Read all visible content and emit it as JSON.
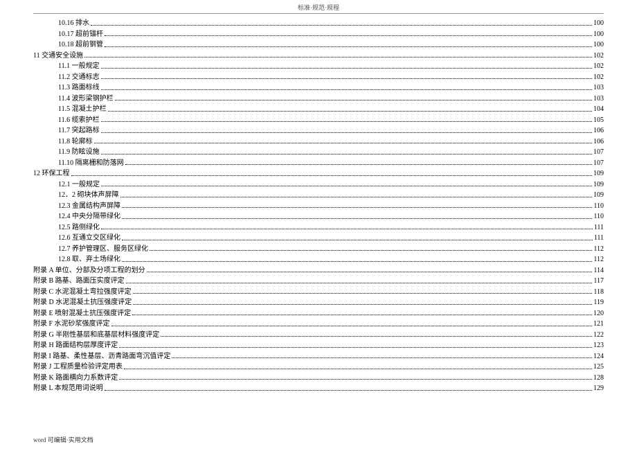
{
  "header": "标准·规范·规程",
  "footer": "word 可编辑·实用文档",
  "toc": [
    {
      "indent": 2,
      "num": "10.16",
      "title": "排水",
      "page": "100"
    },
    {
      "indent": 2,
      "num": "10.17",
      "title": "超前锚杆",
      "page": "100"
    },
    {
      "indent": 2,
      "num": "10.18",
      "title": "超前钢管",
      "page": "100"
    },
    {
      "indent": 0,
      "num": "11",
      "title": "交通安全设施",
      "page": "102"
    },
    {
      "indent": 2,
      "num": "11.1",
      "title": "一般规定",
      "page": "102"
    },
    {
      "indent": 2,
      "num": "11.2",
      "title": "交通标志",
      "page": "102"
    },
    {
      "indent": 2,
      "num": "11.3",
      "title": "路面标线",
      "page": "103"
    },
    {
      "indent": 2,
      "num": "11.4",
      "title": "波形梁钢护栏",
      "page": "103"
    },
    {
      "indent": 2,
      "num": "11.5",
      "title": "混凝土护栏",
      "page": "104"
    },
    {
      "indent": 2,
      "num": "11.6",
      "title": "缆索护栏",
      "page": "105"
    },
    {
      "indent": 2,
      "num": "11.7",
      "title": "突起路标",
      "page": "106"
    },
    {
      "indent": 2,
      "num": "11.8",
      "title": "轮廓标",
      "page": "106"
    },
    {
      "indent": 2,
      "num": "11.9",
      "title": "防眩设施",
      "page": "107"
    },
    {
      "indent": 2,
      "num": "11.10",
      "title": "隔离栅和防落网",
      "page": "107"
    },
    {
      "indent": 0,
      "num": "12",
      "title": "环保工程",
      "page": "109"
    },
    {
      "indent": 2,
      "num": "12.1",
      "title": "一般规定",
      "page": "109"
    },
    {
      "indent": 2,
      "num": "12．2",
      "title": "砌块体声屏障",
      "page": "109"
    },
    {
      "indent": 2,
      "num": "12.3",
      "title": "金属结构声屏障",
      "page": "110"
    },
    {
      "indent": 2,
      "num": "12.4",
      "title": "中央分隔带绿化",
      "page": "110"
    },
    {
      "indent": 2,
      "num": "12.5",
      "title": "路侧绿化",
      "page": "111"
    },
    {
      "indent": 2,
      "num": "12.6",
      "title": "互通立交区绿化",
      "page": "111"
    },
    {
      "indent": 2,
      "num": "12.7",
      "title": "养护管理区、服务区绿化",
      "page": "112"
    },
    {
      "indent": 2,
      "num": "12.8",
      "title": "取、弃土场绿化",
      "page": "112"
    },
    {
      "indent": 0,
      "num": "附录 A",
      "title": "单位、分部及分项工程的划分",
      "page": "114"
    },
    {
      "indent": 0,
      "num": "附录 B",
      "title": "路基、路面压实度评定",
      "page": "117"
    },
    {
      "indent": 0,
      "num": "附录 C",
      "title": "水泥混凝土弯拉强度评定",
      "page": "118"
    },
    {
      "indent": 0,
      "num": "附录 D",
      "title": "水泥混凝土抗压强度评定",
      "page": "119"
    },
    {
      "indent": 0,
      "num": "附录 E",
      "title": "喷射混凝土抗压强度评定",
      "page": "120"
    },
    {
      "indent": 0,
      "num": "附录 F",
      "title": "水泥砂浆强度评定",
      "page": "121"
    },
    {
      "indent": 0,
      "num": "附录 G",
      "title": "半刚性基层和底基层材料强度评定",
      "page": "122"
    },
    {
      "indent": 0,
      "num": "附录 H",
      "title": "路面结构层厚度评定",
      "page": "123"
    },
    {
      "indent": 0,
      "num": "附录 I",
      "title": "路基、柔性基层、沥青路面弯沉值评定",
      "page": "124"
    },
    {
      "indent": 0,
      "num": "附录 J",
      "title": "工程质量检验评定用表",
      "page": "125"
    },
    {
      "indent": 0,
      "num": "附录 K",
      "title": "路面横向力系数评定",
      "page": "128"
    },
    {
      "indent": 0,
      "num": "附录 L",
      "title": "本规范用词说明",
      "page": "129"
    }
  ]
}
